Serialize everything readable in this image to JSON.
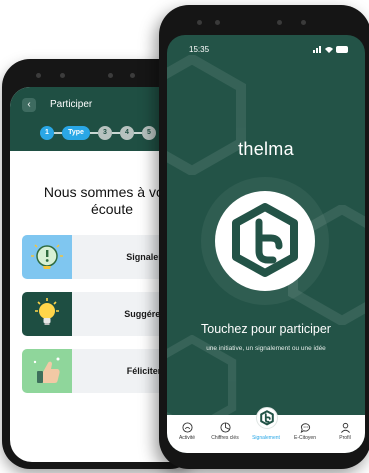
{
  "participate_screen": {
    "back_label": "‹",
    "title": "Participer",
    "stepper": {
      "step1": "1",
      "step_active": "Type",
      "step3": "3",
      "step4": "4",
      "step5": "5"
    },
    "heading_line1": "Nous sommes à votre",
    "heading_line2": "écoute",
    "options": [
      {
        "label": "Signaler",
        "icon": "alert-bulb-icon",
        "color": "#7fc6f0"
      },
      {
        "label": "Suggérer",
        "icon": "lightbulb-icon",
        "color": "#1e4e42"
      },
      {
        "label": "Féliciter",
        "icon": "thumbs-up-icon",
        "color": "#8fd69b"
      }
    ]
  },
  "home_screen": {
    "status_time": "15:35",
    "app_name": "thelma",
    "cta_title": "Touchez pour participer",
    "cta_subtitle": "une initiative, un signalement ou une idée",
    "tabs": [
      {
        "label": "Activité",
        "icon": "home-activity-icon"
      },
      {
        "label": "Chiffres clés",
        "icon": "pie-chart-icon"
      },
      {
        "label": "Signalement",
        "icon": "thelma-logo-icon"
      },
      {
        "label": "E-Citoyen",
        "icon": "chat-icon"
      },
      {
        "label": "Profil",
        "icon": "profile-icon"
      }
    ]
  },
  "colors": {
    "brand_green": "#235347",
    "accent_blue": "#2aa7e6",
    "card_bg": "#f0f2f4"
  }
}
